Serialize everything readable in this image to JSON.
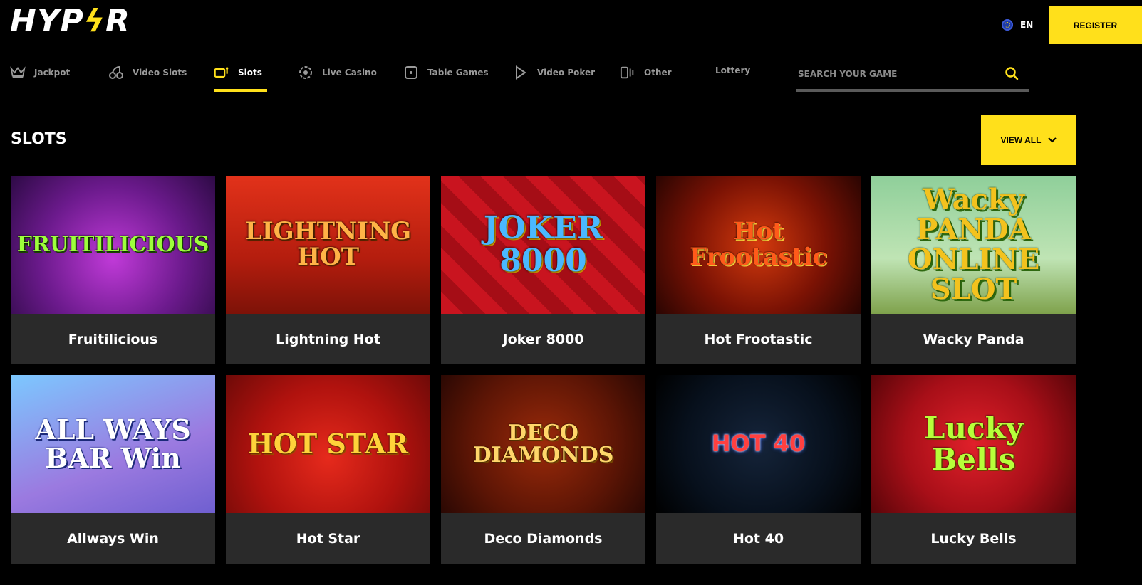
{
  "brand": {
    "logo_text_a": "HYP",
    "logo_text_bolt": "ϟ",
    "logo_text_b": "R",
    "accent": "#ffe01b"
  },
  "header": {
    "language": "EN",
    "register_label": "REGISTER"
  },
  "nav": {
    "items": [
      {
        "label": "Jackpot",
        "icon": "crown-icon",
        "active": false
      },
      {
        "label": "Video Slots",
        "icon": "cherries-icon",
        "active": false
      },
      {
        "label": "Slots",
        "icon": "slot-machine-icon",
        "active": true
      },
      {
        "label": "Live Casino",
        "icon": "chip-icon",
        "active": false
      },
      {
        "label": "Table Games",
        "icon": "table-icon",
        "active": false
      },
      {
        "label": "Video Poker",
        "icon": "play-icon",
        "active": false
      },
      {
        "label": "Other",
        "icon": "other-icon",
        "active": false
      },
      {
        "label": "Lottery",
        "icon": "",
        "active": false
      }
    ]
  },
  "search": {
    "placeholder": "SEARCH YOUR GAME",
    "value": ""
  },
  "section": {
    "title": "SLOTS",
    "view_all_label": "VIEW ALL"
  },
  "games": [
    {
      "title": "Fruitilicious",
      "art_text": "FRUITILICIOUS"
    },
    {
      "title": "Lightning Hot",
      "art_text": "LIGHTNING HOT"
    },
    {
      "title": "Joker 8000",
      "art_text": "JOKER 8000"
    },
    {
      "title": "Hot Frootastic",
      "art_text": "Hot Frootastic"
    },
    {
      "title": "Wacky Panda",
      "art_text": "Wacky PANDA ONLINE SLOT"
    },
    {
      "title": "Allways Win",
      "art_text": "ALL WAYS BAR Win"
    },
    {
      "title": "Hot Star",
      "art_text": "HOT STAR"
    },
    {
      "title": "Deco Diamonds",
      "art_text": "DECO DIAMONDS"
    },
    {
      "title": "Hot 40",
      "art_text": "HOT 40"
    },
    {
      "title": "Lucky Bells",
      "art_text": "Lucky Bells"
    }
  ]
}
